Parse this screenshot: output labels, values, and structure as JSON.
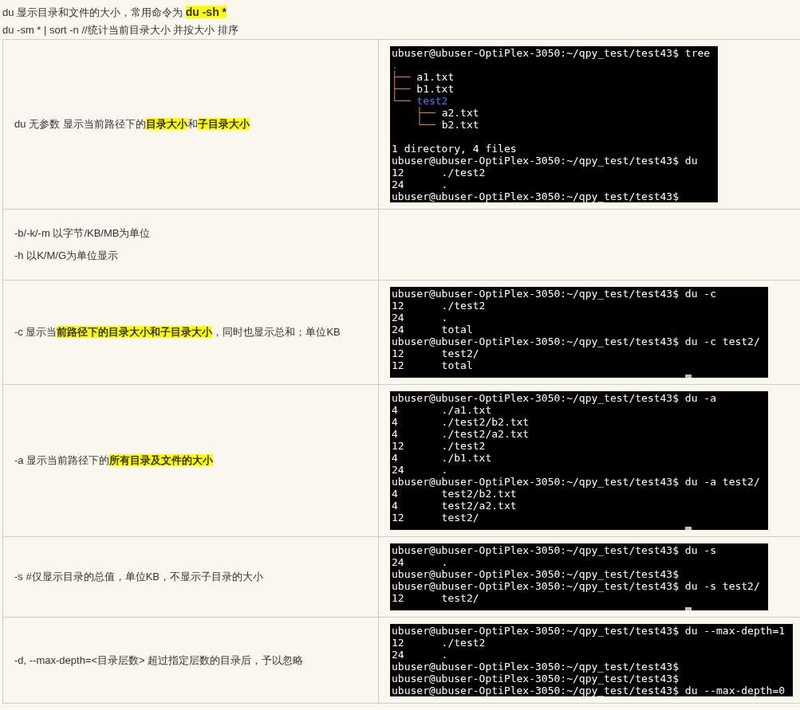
{
  "intro": [
    "du 显示目录和文件的大小，常用命令为 **du -sh ***",
    "du -sm * | sort -n //统计当前目录大小 并按大小 排序"
  ],
  "rows": [
    {
      "description": [
        "du 无参数 显示当前路径下的**目录大小**和**子目录大小**"
      ],
      "terminal": {
        "cursor": false,
        "lines": [
          {
            "text": "ubuser@ubuser-OptiPlex-3050:~/qpy_test/test43$ tree"
          },
          {
            "parts": [
              {
                "kind": "dir",
                "text": "."
              }
            ]
          },
          {
            "parts": [
              {
                "kind": "branch",
                "text": "├── "
              },
              {
                "kind": "file",
                "text": "a1.txt"
              }
            ]
          },
          {
            "parts": [
              {
                "kind": "branch",
                "text": "├── "
              },
              {
                "kind": "file",
                "text": "b1.txt"
              }
            ]
          },
          {
            "parts": [
              {
                "kind": "branch",
                "text": "└── "
              },
              {
                "kind": "dir",
                "text": "test2"
              }
            ]
          },
          {
            "parts": [
              {
                "kind": "branch",
                "text": "    ├── "
              },
              {
                "kind": "file",
                "text": "a2.txt"
              }
            ]
          },
          {
            "parts": [
              {
                "kind": "branch",
                "text": "    └── "
              },
              {
                "kind": "file",
                "text": "b2.txt"
              }
            ]
          },
          {
            "text": "1 directory, 4 files",
            "blank_before": true
          },
          {
            "text": "ubuser@ubuser-OptiPlex-3050:~/qpy_test/test43$ du"
          },
          {
            "text": "12      ./test2"
          },
          {
            "text": "24      ."
          },
          {
            "text": "ubuser@ubuser-OptiPlex-3050:~/qpy_test/test43$"
          }
        ]
      }
    },
    {
      "description": [
        "-b/-k/-m 以字节/KB/MB为单位",
        "-h 以K/M/G为单位显示"
      ]
    },
    {
      "description": [
        "-c 显示当**前路径下的目录大小和子目录大小**，同时也显示总和；单位KB"
      ],
      "terminal": {
        "cursor": true,
        "lines": [
          {
            "text": "ubuser@ubuser-OptiPlex-3050:~/qpy_test/test43$ du -c"
          },
          {
            "text": "12      ./test2"
          },
          {
            "text": "24      ."
          },
          {
            "text": "24      total"
          },
          {
            "text": "ubuser@ubuser-OptiPlex-3050:~/qpy_test/test43$ du -c test2/"
          },
          {
            "text": "12      test2/"
          },
          {
            "text": "12      total"
          }
        ]
      }
    },
    {
      "description": [
        "-a 显示当前路径下的**所有目录及文件的大小**"
      ],
      "terminal": {
        "cursor": true,
        "lines": [
          {
            "text": "ubuser@ubuser-OptiPlex-3050:~/qpy_test/test43$ du -a"
          },
          {
            "text": "4       ./a1.txt"
          },
          {
            "text": "4       ./test2/b2.txt"
          },
          {
            "text": "4       ./test2/a2.txt"
          },
          {
            "text": "12      ./test2"
          },
          {
            "text": "4       ./b1.txt"
          },
          {
            "text": "24      ."
          },
          {
            "text": "ubuser@ubuser-OptiPlex-3050:~/qpy_test/test43$ du -a test2/"
          },
          {
            "text": "4       test2/b2.txt"
          },
          {
            "text": "4       test2/a2.txt"
          },
          {
            "text": "12      test2/"
          }
        ]
      }
    },
    {
      "description": [
        "-s  #仅显示目录的总值，单位KB，不显示子目录的大小"
      ],
      "terminal": {
        "cursor": true,
        "lines": [
          {
            "text": "ubuser@ubuser-OptiPlex-3050:~/qpy_test/test43$ du -s"
          },
          {
            "text": "24      ."
          },
          {
            "text": "ubuser@ubuser-OptiPlex-3050:~/qpy_test/test43$"
          },
          {
            "text": "ubuser@ubuser-OptiPlex-3050:~/qpy_test/test43$ du -s test2/"
          },
          {
            "text": "12      test2/"
          }
        ]
      }
    },
    {
      "description": [
        "-d, --max-depth=<目录层数> 超过指定层数的目录后，予以忽略"
      ],
      "terminal": {
        "cursor": false,
        "lines": [
          {
            "text": "ubuser@ubuser-OptiPlex-3050:~/qpy_test/test43$ du --max-depth=1"
          },
          {
            "text": "12      ./test2"
          },
          {
            "text": "24      ."
          },
          {
            "text": "ubuser@ubuser-OptiPlex-3050:~/qpy_test/test43$"
          },
          {
            "text": "ubuser@ubuser-OptiPlex-3050:~/qpy_test/test43$"
          },
          {
            "text": "ubuser@ubuser-OptiPlex-3050:~/qpy_test/test43$ du --max-depth=0"
          }
        ]
      }
    }
  ]
}
